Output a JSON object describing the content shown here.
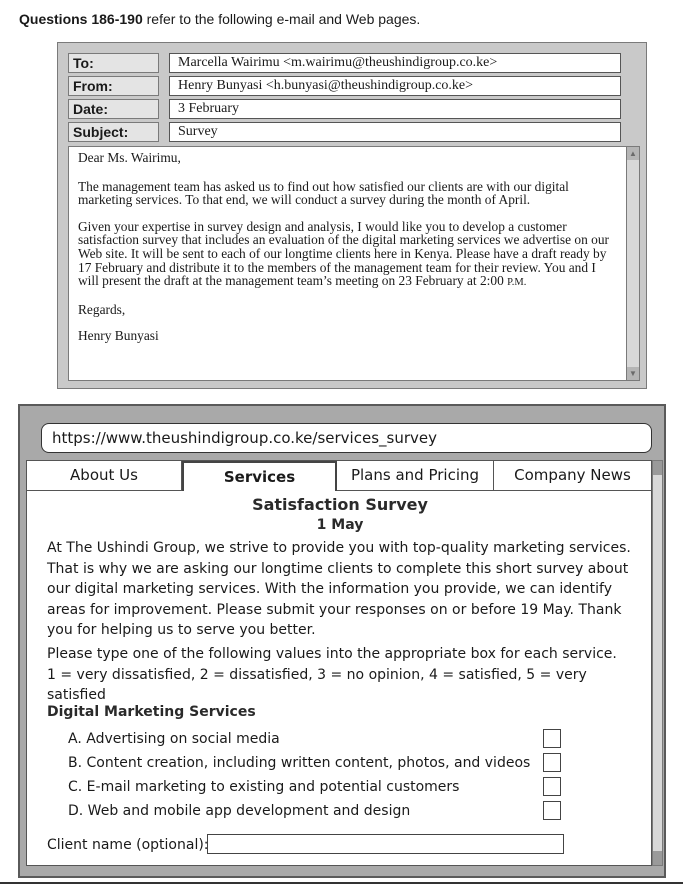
{
  "heading": {
    "bold": "Questions 186-190",
    "rest": " refer to the following e-mail and Web pages."
  },
  "email": {
    "fields": [
      {
        "label": "To:",
        "value": "Marcella Wairimu <m.wairimu@theushindigroup.co.ke>"
      },
      {
        "label": "From:",
        "value": "Henry Bunyasi <h.bunyasi@theushindigroup.co.ke>"
      },
      {
        "label": "Date:",
        "value": "3 February"
      },
      {
        "label": "Subject:",
        "value": "Survey"
      }
    ],
    "salutation": "Dear Ms. Wairimu,",
    "paragraph1": "The management team has asked us to find out how satisfied our clients are with our digital marketing services. To that end, we will conduct a survey during the month of April.",
    "paragraph2_before_time": "Given your expertise in survey design and analysis, I would like you to develop a customer satisfaction survey that includes an evaluation of the digital marketing services we advertise on our Web site. It will be sent to each of our longtime clients here in Kenya. Please have a draft ready by 17 February and distribute it to the members of the management team for their review. You and I will present the draft at the management team’s meeting on 23 February at 2:00 ",
    "paragraph2_time_suffix": "P.M.",
    "closing": "Regards,",
    "signature": "Henry Bunyasi"
  },
  "browser": {
    "url": "https://www.theushindigroup.co.ke/services_survey",
    "tabs": [
      "About Us",
      "Services",
      "Plans and Pricing",
      "Company News"
    ],
    "active_tab": "Services"
  },
  "survey": {
    "title": "Satisfaction Survey",
    "date": "1 May",
    "intro": "At The Ushindi Group, we strive to provide you with top-quality marketing services. That is why we are asking our longtime clients to complete this short survey about our digital marketing services. With the information you provide, we can identify areas for improvement. Please submit your responses on or before 19 May. Thank you for helping us to serve you better.",
    "instruction_line1": "Please type one of the following values into the appropriate box for each service.",
    "instruction_line2": "1 = very dissatisfied, 2 = dissatisfied, 3 = no opinion, 4 = satisfied, 5 = very satisfied",
    "section_heading": "Digital Marketing Services",
    "services": [
      "A. Advertising on social media",
      "B. Content creation, including written content, photos, and videos",
      "C. E-mail marketing to existing and potential customers",
      "D. Web and mobile app development and design"
    ],
    "client_name_label": "Client name (optional):"
  }
}
